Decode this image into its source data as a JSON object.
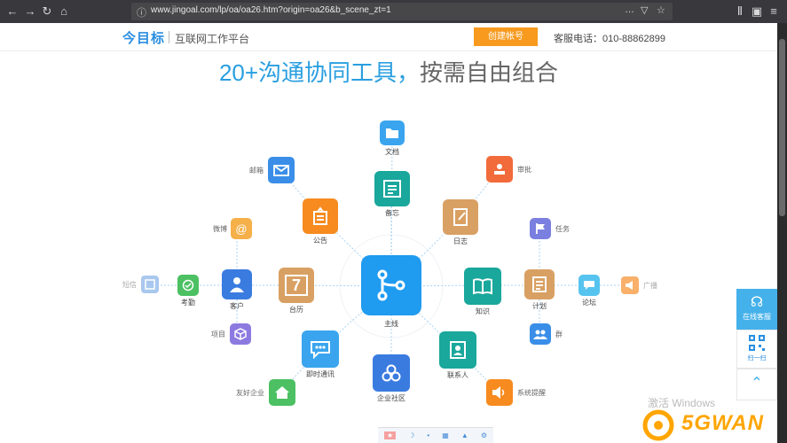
{
  "browser": {
    "url": "www.jingoal.com/lp/oa/oa26.htm?origin=oa26&b_scene_zt=1",
    "more_icon": "…"
  },
  "header": {
    "logo": "今目标",
    "slogan": "互联网工作平台",
    "create_button": "创建帐号",
    "phone": "客服电话：010-88862899"
  },
  "headline": {
    "highlight": "20+沟通协同工具，",
    "rest": "按需自由组合"
  },
  "hub": {
    "label": "主线",
    "color": "#1f9bf0",
    "icon": "branch-icon"
  },
  "tools": [
    {
      "key": "wenku",
      "label": "文档",
      "color": "#3aa5ee",
      "icon": "folder-icon"
    },
    {
      "key": "beiwang",
      "label": "备忘",
      "color": "#1aa79c",
      "icon": "notes-icon"
    },
    {
      "key": "gonggao",
      "label": "公告",
      "color": "#f78b1f",
      "icon": "bulletin-icon"
    },
    {
      "key": "rizhi",
      "label": "日志",
      "color": "#d9a063",
      "icon": "journal-icon"
    },
    {
      "key": "taili",
      "label": "台历",
      "color": "#d9a063",
      "icon": "calendar-icon",
      "text": "7"
    },
    {
      "key": "zhishi",
      "label": "知识",
      "color": "#1aa79c",
      "icon": "book-icon"
    },
    {
      "key": "jishi",
      "label": "即时通讯",
      "color": "#3aa5ee",
      "icon": "chat-icon"
    },
    {
      "key": "lianxi",
      "label": "联系人",
      "color": "#1aa79c",
      "icon": "contact-icon"
    },
    {
      "key": "qiye",
      "label": "企业社区",
      "color": "#3a7be0",
      "icon": "community-icon"
    },
    {
      "key": "kehu",
      "label": "客户",
      "color": "#3a7be0",
      "icon": "customer-icon"
    },
    {
      "key": "jihua",
      "label": "计划",
      "color": "#d9a063",
      "icon": "plan-icon"
    }
  ],
  "side_items": [
    {
      "key": "youxiang",
      "label": "邮箱",
      "color": "#3a8ee8",
      "icon": "mail-icon"
    },
    {
      "key": "shenpi",
      "label": "审批",
      "color": "#f26b3a",
      "icon": "stamp-icon"
    },
    {
      "key": "weibo",
      "label": "微博",
      "color": "#f5b04a",
      "icon": "at-icon"
    },
    {
      "key": "renwu",
      "label": "任务",
      "color": "#7a7fe0",
      "icon": "flag-icon"
    },
    {
      "key": "duanxin",
      "label": "短信",
      "color": "#a9c8ee",
      "icon": "sms-icon"
    },
    {
      "key": "kaoqin",
      "label": "考勤",
      "color": "#4cc062",
      "icon": "check-icon"
    },
    {
      "key": "luntan",
      "label": "论坛",
      "color": "#56c4ee",
      "icon": "forum-icon"
    },
    {
      "key": "guangbo",
      "label": "广播",
      "color": "#f8b06a",
      "icon": "broadcast-icon"
    },
    {
      "key": "xiangmu",
      "label": "项目",
      "color": "#8c7ae0",
      "icon": "cube-icon"
    },
    {
      "key": "qun",
      "label": "群",
      "color": "#3a8ee8",
      "icon": "group-icon"
    },
    {
      "key": "youhao",
      "label": "友好企业",
      "color": "#4cc062",
      "icon": "house-icon"
    },
    {
      "key": "tixing",
      "label": "系统提醒",
      "color": "#f78b1f",
      "icon": "speaker-icon"
    }
  ],
  "float_panel": {
    "service_label": "在线客服",
    "qr_label": "扫一扫",
    "top_icon": "chevron-up-icon"
  },
  "os_overlay": {
    "activate": "激活 Windows"
  },
  "watermark": {
    "text": "5GWAN"
  }
}
